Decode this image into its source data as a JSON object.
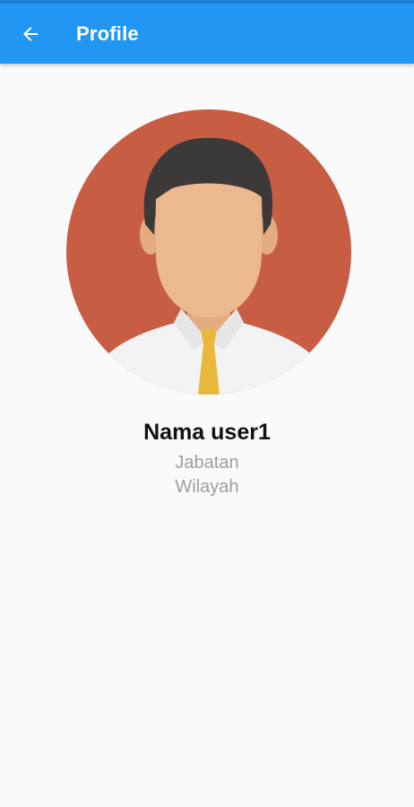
{
  "app_bar": {
    "title": "Profile",
    "back_icon": "arrow-left-icon",
    "background_color": "#2196f3"
  },
  "profile": {
    "avatar": "male-avatar-illustration",
    "avatar_background_color": "#c75e44",
    "name": "Nama user1",
    "position": "Jabatan",
    "region": "Wilayah"
  }
}
